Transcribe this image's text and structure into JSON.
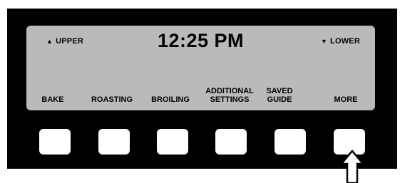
{
  "display": {
    "upper_label": "UPPER",
    "lower_label": "LOWER",
    "time": "12:25 PM"
  },
  "softkeys": [
    {
      "line1": "",
      "line2": "BAKE"
    },
    {
      "line1": "",
      "line2": "ROASTING"
    },
    {
      "line1": "",
      "line2": "BROILING"
    },
    {
      "line1": "ADDITIONAL",
      "line2": "SETTINGS"
    },
    {
      "line1": "SAVED",
      "line2": "GUIDE"
    },
    {
      "line1": "",
      "line2": "MORE"
    }
  ],
  "icons": {
    "upper": "triangle-up-icon",
    "lower": "triangle-down-icon",
    "pointer": "up-arrow-icon"
  },
  "colors": {
    "panel": "#000000",
    "lcd": "#b8babc",
    "button": "#ffffff"
  }
}
